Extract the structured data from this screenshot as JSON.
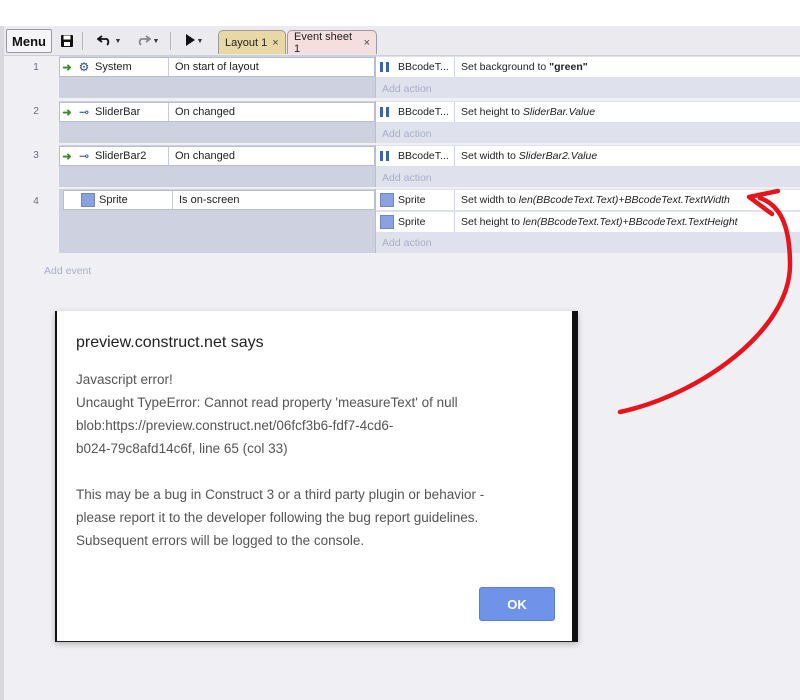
{
  "toolbar": {
    "menu_label": "Menu",
    "icons": [
      "save-icon",
      "undo-icon",
      "redo-icon",
      "play-icon"
    ]
  },
  "tabs": [
    {
      "label": "Layout 1",
      "close": "×",
      "color": "#e8d8a4"
    },
    {
      "label": "Event sheet 1",
      "close": "×",
      "color": "#f4dede"
    }
  ],
  "events": [
    {
      "number": "1",
      "object": "System",
      "object_icon": "gear-icon",
      "condition": "On start of layout",
      "actions": [
        {
          "object": "BBcodeT...",
          "icon": "bbcode-icon",
          "text": "Set background to ",
          "bold": "\"green\"",
          "italic": ""
        }
      ],
      "add_action": "Add action"
    },
    {
      "number": "2",
      "object": "SliderBar",
      "object_icon": "slider-icon",
      "condition": "On changed",
      "actions": [
        {
          "object": "BBcodeT...",
          "icon": "bbcode-icon",
          "text": "Set height to ",
          "bold": "",
          "italic": "SliderBar.Value"
        }
      ],
      "add_action": "Add action"
    },
    {
      "number": "3",
      "object": "SliderBar2",
      "object_icon": "slider-icon",
      "condition": "On changed",
      "actions": [
        {
          "object": "BBcodeT...",
          "icon": "bbcode-icon",
          "text": "Set width to ",
          "bold": "",
          "italic": "SliderBar2.Value"
        }
      ],
      "add_action": "Add action"
    },
    {
      "number": "4",
      "object": "Sprite",
      "object_icon": "sprite-icon",
      "condition": "Is on-screen",
      "actions": [
        {
          "object": "Sprite",
          "icon": "sprite-icon",
          "text": "Set width to ",
          "bold": "",
          "italic": "len(BBcodeText.Text)+BBcodeText.TextWidth"
        },
        {
          "object": "Sprite",
          "icon": "sprite-icon",
          "text": "Set height to ",
          "bold": "",
          "italic": "len(BBcodeText.Text)+BBcodeText.TextHeight"
        }
      ],
      "add_action": "Add action"
    }
  ],
  "add_event": "Add event",
  "dialog": {
    "title": "preview.construct.net says",
    "lines": [
      "Javascript error!",
      "Uncaught TypeError: Cannot read property 'measureText' of null",
      "blob:https://preview.construct.net/06fcf3b6-fdf7-4cd6-",
      "b024-79c8afd14c6f, line 65 (col 33)"
    ],
    "lines2": [
      "This may be a bug in Construct 3 or a third party plugin or behavior -",
      "please report it to the developer following the bug report guidelines.",
      "Subsequent errors will be logged to the console."
    ],
    "ok_label": "OK"
  },
  "colors": {
    "annotation": "#e8141c",
    "ok_button": "#6e93e8",
    "event_block": "#cdd1e0"
  }
}
